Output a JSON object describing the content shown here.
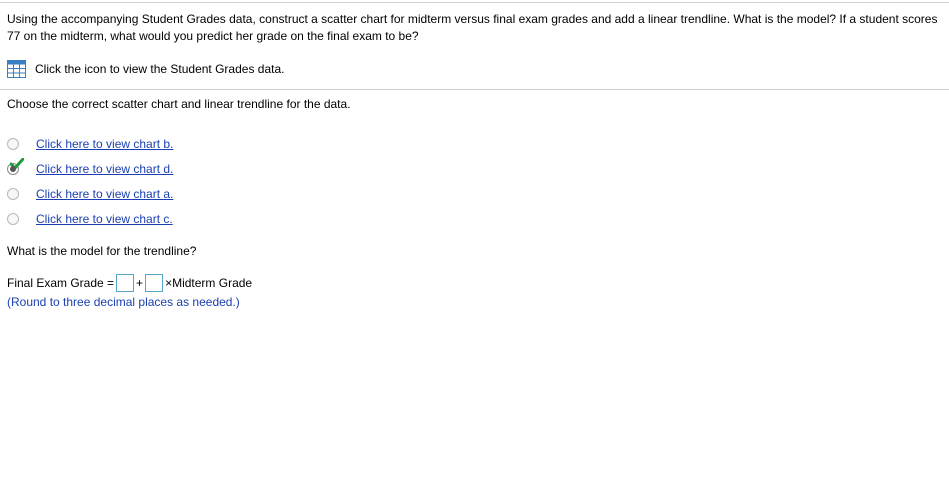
{
  "question": {
    "text": "Using the accompanying Student Grades data, construct a scatter chart for midterm versus final exam grades and add a linear trendline. What is the model? If a student scores 77 on the midterm, what would you predict her grade on the final exam to be?"
  },
  "data_link": {
    "icon": "table-grid-icon",
    "label": "Click the icon to view the Student Grades data."
  },
  "instruction": "Choose the correct scatter chart and linear trendline for the data.",
  "options": [
    {
      "label": "Click here to view chart b.",
      "selected": false
    },
    {
      "label": "Click here to view chart d.",
      "selected": true,
      "correct_mark": true
    },
    {
      "label": "Click here to view chart a.",
      "selected": false
    },
    {
      "label": "Click here to view chart c.",
      "selected": false
    }
  ],
  "model_question": "What is the model for the trendline?",
  "equation": {
    "lhs": "Final Exam Grade =",
    "plus": "+",
    "times": "×",
    "rhs": "Midterm Grade",
    "intercept_value": "",
    "slope_value": ""
  },
  "round_note": "(Round to three decimal places as needed.)",
  "colors": {
    "link": "#1a3fb2",
    "check": "#1f9a3a",
    "input_border": "#57a8c8",
    "icon_blue": "#3a7fc1"
  }
}
